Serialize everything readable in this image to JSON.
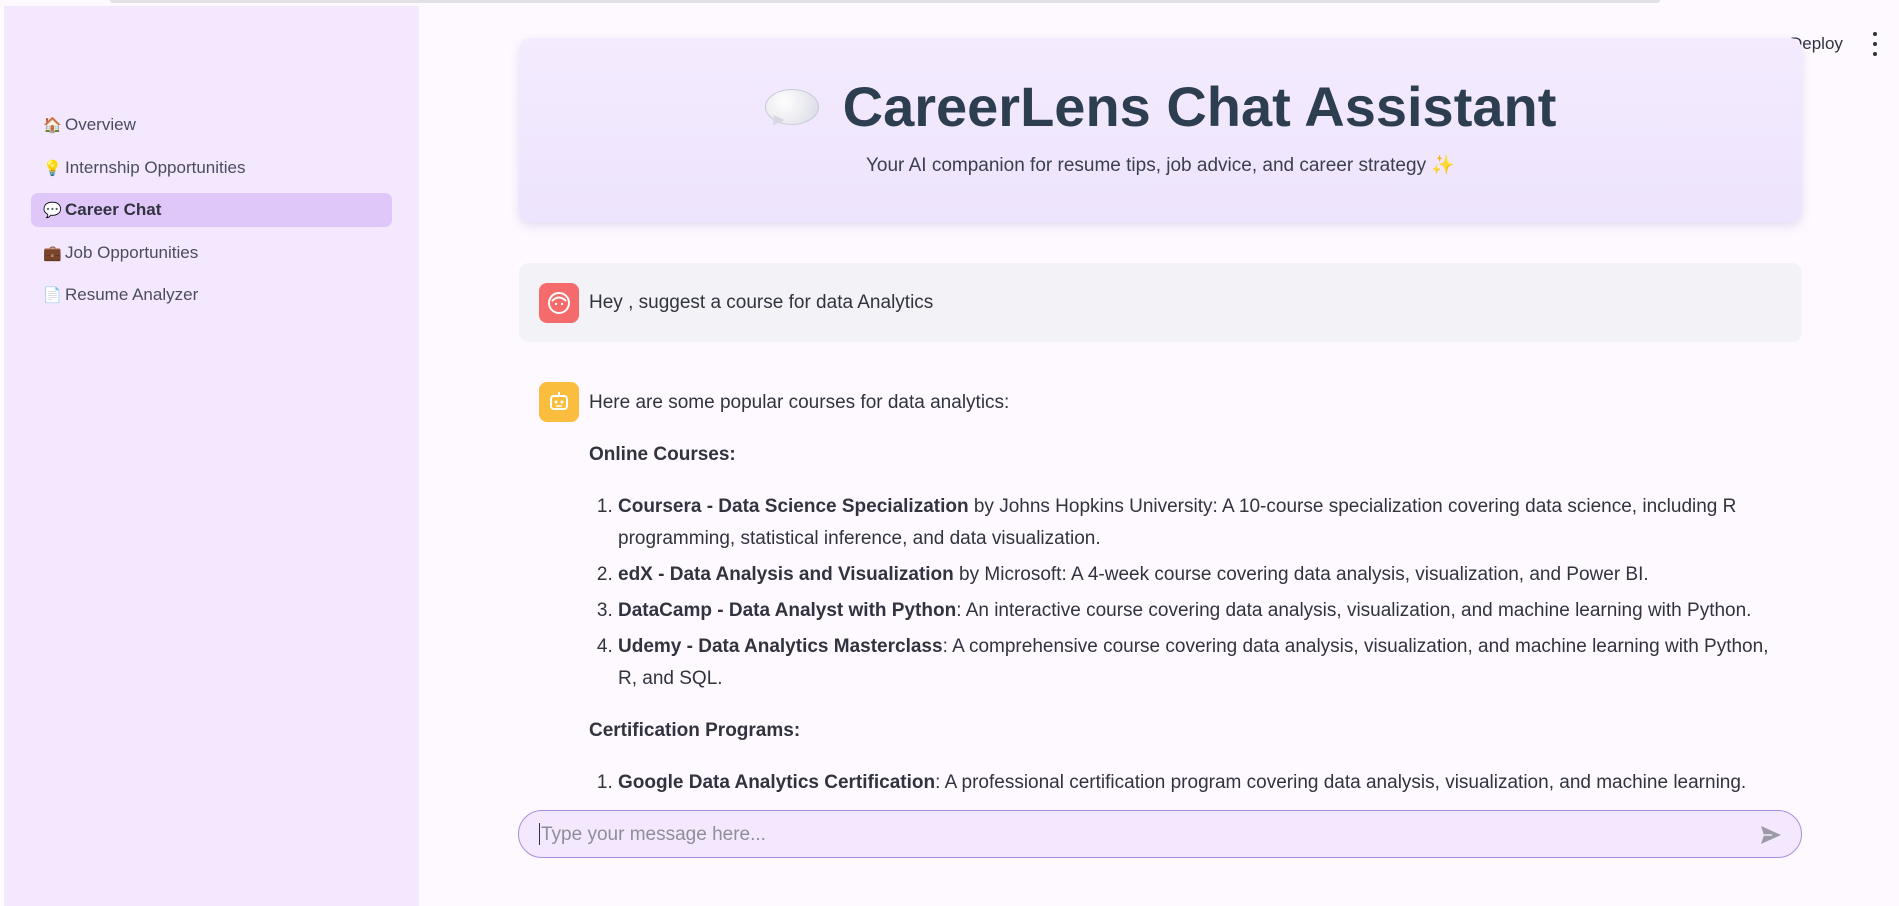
{
  "sidebar": {
    "items": [
      {
        "icon": "🏠",
        "label": "Overview",
        "active": false
      },
      {
        "icon": "💡",
        "label": "Internship Opportunities",
        "active": false
      },
      {
        "icon": "💬",
        "label": "Career Chat",
        "active": true
      },
      {
        "icon": "💼",
        "label": "Job Opportunities",
        "active": false
      },
      {
        "icon": "📄",
        "label": "Resume Analyzer",
        "active": false
      }
    ]
  },
  "topbar": {
    "deploy_label": "Deploy"
  },
  "header": {
    "title": "CareerLens Chat Assistant",
    "subtitle": "Your AI companion for resume tips, job advice, and career strategy ✨"
  },
  "chat": {
    "user_message": "Hey , suggest a course for data Analytics",
    "bot_intro": "Here are some popular courses for data analytics:",
    "online_heading": "Online Courses:",
    "online_courses": [
      {
        "name": "Coursera - Data Science Specialization",
        "desc": " by Johns Hopkins University: A 10-course specialization covering data science, including R programming, statistical inference, and data visualization."
      },
      {
        "name": "edX - Data Analysis and Visualization",
        "desc": " by Microsoft: A 4-week course covering data analysis, visualization, and Power BI."
      },
      {
        "name": "DataCamp - Data Analyst with Python",
        "desc": ": An interactive course covering data analysis, visualization, and machine learning with Python."
      },
      {
        "name": "Udemy - Data Analytics Masterclass",
        "desc": ": A comprehensive course covering data analysis, visualization, and machine learning with Python, R, and SQL."
      }
    ],
    "cert_heading": "Certification Programs:",
    "cert_programs": [
      {
        "name": "Google Data Analytics Certification",
        "desc": ": A professional certification program covering data analysis, visualization, and machine learning."
      }
    ]
  },
  "input": {
    "placeholder": "Type your message here..."
  },
  "colors": {
    "sidebar_bg": "#f3e8fd",
    "active_nav": "#dfc7fa",
    "title": "#2c3e50",
    "user_avatar": "#f56b6b",
    "bot_avatar": "#fbbd3d"
  }
}
